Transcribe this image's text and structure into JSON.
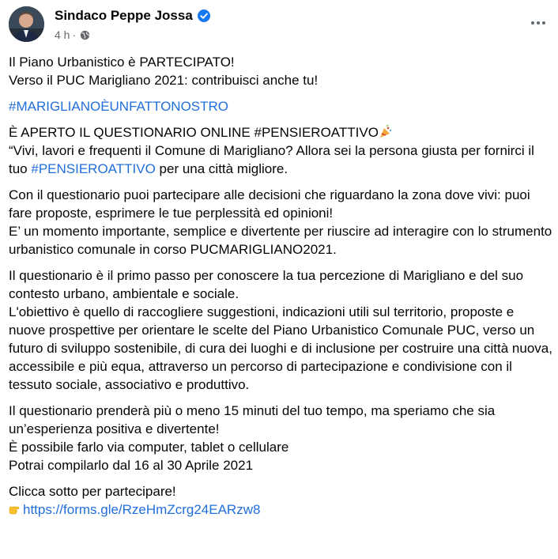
{
  "header": {
    "author": "Sindaco Peppe Jossa",
    "time": "4 h",
    "separator": "·"
  },
  "post": {
    "p1_l1": "Il Piano Urbanistico è PARTECIPATO!",
    "p1_l2": "Verso il PUC Marigliano 2021: contribuisci anche tu!",
    "hashtag1": "#MARIGLIANOÈUNFATTONOSTRO",
    "p3_l1": "È APERTO IL QUESTIONARIO ONLINE #PENSIEROATTIVO",
    "p3_l2a": "“Vivi, lavori e frequenti il Comune di Marigliano? Allora sei la persona giusta per fornirci il tuo ",
    "hashtag2": "#PENSIEROATTIVO",
    "p3_l2b": " per una città migliore.",
    "p4_l1": "Con il questionario puoi partecipare alle decisioni che riguardano la zona dove vivi: puoi fare proposte, esprimere le tue perplessità ed opinioni!",
    "p4_l2": "E’ un momento importante, semplice e divertente per riuscire ad interagire con lo strumento urbanistico comunale in corso PUCMARIGLIANO2021.",
    "p5_l1": "Il questionario è il primo passo per conoscere la tua percezione di Marigliano e del suo contesto urbano, ambientale e sociale.",
    "p5_l2": "L'obiettivo è quello di raccogliere suggestioni, indicazioni utili sul territorio, proposte e nuove prospettive per orientare le scelte del Piano Urbanistico Comunale PUC, verso un futuro di sviluppo sostenibile, di cura dei luoghi e di inclusione per costruire una città nuova, accessibile e più equa, attraverso un percorso di partecipazione e condivisione con il tessuto sociale, associativo e produttivo.",
    "p6_l1": "Il questionario prenderà più o meno 15 minuti del tuo tempo, ma speriamo che sia un’esperienza positiva e divertente!",
    "p6_l2": "È possibile farlo via computer, tablet o cellulare",
    "p6_l3": "Potrai compilarlo dal 16 al 30 Aprile 2021",
    "p7_l1": "Clicca sotto per partecipare!",
    "url": "https://forms.gle/RzeHmZcrg24EARzw8"
  },
  "icons": {
    "verified": "verified-badge-icon",
    "globe": "globe-icon",
    "more": "more-options-icon",
    "party": "party-popper-icon",
    "pointer": "pointing-hand-icon"
  },
  "colors": {
    "link": "#216fdb",
    "verified": "#1877f2",
    "meta": "#65676b"
  }
}
